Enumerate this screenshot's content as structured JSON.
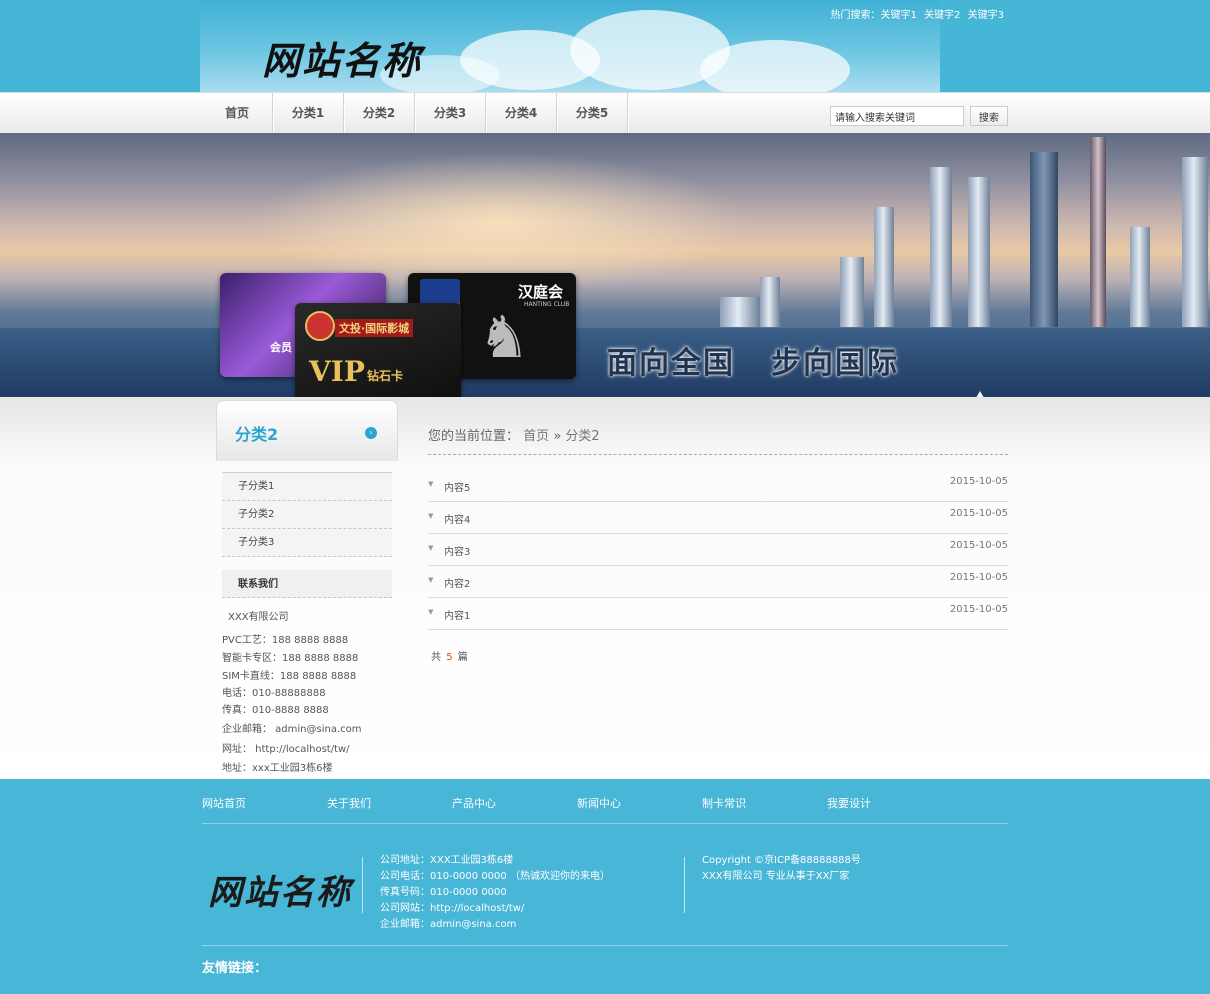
{
  "site": {
    "logo": "网站名称"
  },
  "header": {
    "hot_label": "热门搜索：",
    "hot_keywords": [
      "关键字1",
      "关键字2",
      "关键字3"
    ]
  },
  "nav": {
    "items": [
      "首页",
      "分类1",
      "分类2",
      "分类3",
      "分类4",
      "分类5"
    ],
    "search_placeholder": "请输入搜索关键词",
    "search_button": "搜索"
  },
  "banner": {
    "slogan_left": "面向全国",
    "slogan_right": "步向国际",
    "card_hanting_name": "汉庭会",
    "card_hanting_sub": "HANTING CLUB",
    "card_vip_name": "文投·国际影城",
    "card_vip_big": "VIP",
    "card_vip_small": "钻石卡",
    "card_member": "会员"
  },
  "sidebar": {
    "title": "分类2",
    "subcategories": [
      "子分类1",
      "子分类2",
      "子分类3"
    ],
    "contact_title": "联系我们",
    "contact_lines": [
      "XXX有限公司",
      "PVC工艺：188 8888 8888",
      "智能卡专区：188 8888 8888",
      "SIM卡直线：188 8888 8888",
      "电话：010-88888888",
      "传真：010-8888 8888",
      "企业邮箱： admin@sina.com",
      "网址： http://localhost/tw/",
      "地址：xxx工业园3栋6楼"
    ]
  },
  "content": {
    "breadcrumb_label": "您的当前位置：",
    "breadcrumb_home": "首页",
    "breadcrumb_sep": "»",
    "breadcrumb_current": "分类2",
    "items": [
      {
        "title": "内容5",
        "date": "2015-10-05"
      },
      {
        "title": "内容4",
        "date": "2015-10-05"
      },
      {
        "title": "内容3",
        "date": "2015-10-05"
      },
      {
        "title": "内容2",
        "date": "2015-10-05"
      },
      {
        "title": "内容1",
        "date": "2015-10-05"
      }
    ],
    "total_prefix": "共",
    "total_count": "5",
    "total_suffix": "篇"
  },
  "footer": {
    "nav": [
      "网站首页",
      "关于我们",
      "产品中心",
      "新闻中心",
      "制卡常识",
      "我要设计"
    ],
    "logo": "网站名称",
    "info": [
      "公司地址：XXX工业园3栋6楼",
      "公司电话：010-0000 0000 （热诚欢迎你的来电）",
      "传真号码：010-0000 0000",
      "公司网站：http://localhost/tw/",
      "企业邮箱：admin@sina.com"
    ],
    "copyright": [
      "Copyright ©京ICP备88888888号",
      "XXX有限公司 专业从事于XX厂家"
    ],
    "links_label": "友情链接："
  },
  "colors": {
    "header_blue": "#46b6d7",
    "accent_blue": "#2aa6d6",
    "footer_blue": "#48b6d6",
    "count_orange": "#d9531e"
  },
  "icons": [
    "arrow-circle-icon",
    "triangle-down-icon"
  ]
}
